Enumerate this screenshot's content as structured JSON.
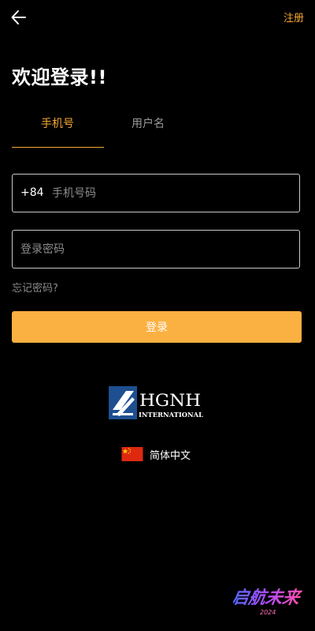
{
  "header": {
    "back_icon": "arrow-left-icon",
    "register_label": "注册"
  },
  "title": "欢迎登录!!",
  "tabs": [
    {
      "label": "手机号",
      "active": true
    },
    {
      "label": "用户名",
      "active": false
    }
  ],
  "phone_field": {
    "country_code": "+84",
    "placeholder": "手机号码",
    "value": ""
  },
  "password_field": {
    "placeholder": "登录密码",
    "value": ""
  },
  "forgot_password_label": "忘记密码?",
  "login_button_label": "登录",
  "logo": {
    "main_text": "HGNH",
    "sub_text": "INTERNATIONAL"
  },
  "language": {
    "flag_icon": "china-flag-icon",
    "label": "简体中文"
  },
  "watermark": {
    "text": "启航未来",
    "sub_text": "2024"
  },
  "colors": {
    "background": "#000000",
    "accent": "#f5a731",
    "button": "#fbb042",
    "logo_blue": "#1d4f91",
    "flag_red": "#de2910",
    "flag_star": "#ffde00"
  }
}
